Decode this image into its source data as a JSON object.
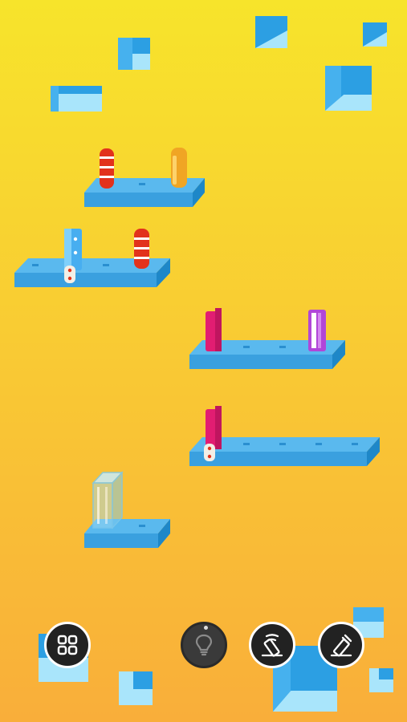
{
  "colors": {
    "background_top": "#f7e42b",
    "background_bottom": "#f9ae3a",
    "platform_top": "#5ab9ee",
    "platform_front": "#3aa0df",
    "cube_light": "#a9e5fb",
    "cube_dark": "#2c9fe3",
    "domino_red": "#e2321c",
    "domino_orange": "#f0a524",
    "domino_blue": "#47aef0",
    "domino_pink": "#e21d72",
    "domino_purple": "#b146d8",
    "domino_glass": "#9ed9f2"
  },
  "controls": {
    "menu_button": {
      "icon": "grid-icon"
    },
    "hint_button": {
      "icon": "lightbulb-icon",
      "state": "disabled"
    },
    "push_left_button": {
      "icon": "domino-fall-left-icon"
    },
    "push_right_button": {
      "icon": "domino-fall-right-icon"
    }
  },
  "level": {
    "platforms": [
      {
        "name": "platform-1",
        "pieces": [
          "red-striped-domino",
          "orange-domino"
        ]
      },
      {
        "name": "platform-2",
        "pieces": [
          "blue-dotted-domino",
          "red-striped-domino"
        ]
      },
      {
        "name": "platform-3",
        "pieces": [
          "pink-domino",
          "purple-domino"
        ]
      },
      {
        "name": "platform-4",
        "pieces": [
          "pink-domino"
        ]
      },
      {
        "name": "platform-5",
        "pieces": [
          "glass-domino"
        ]
      }
    ]
  }
}
